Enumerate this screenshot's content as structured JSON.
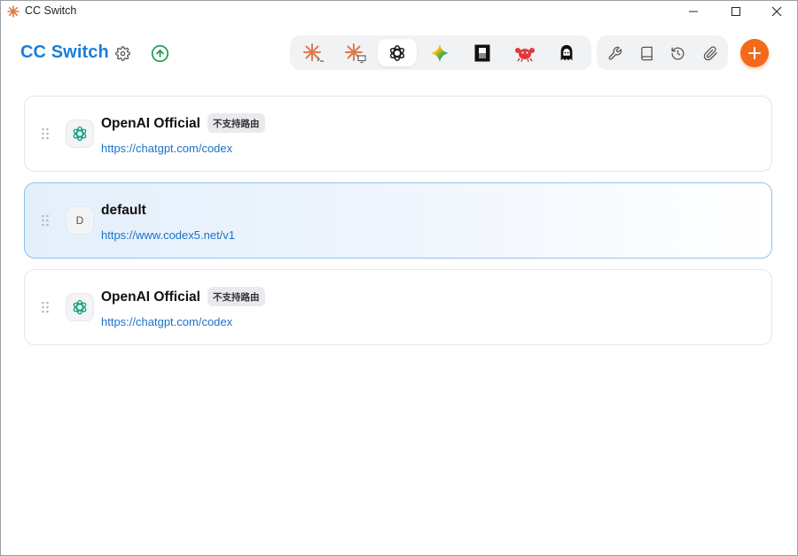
{
  "window": {
    "title": "CC Switch",
    "controls": [
      "minimize",
      "maximize",
      "close"
    ]
  },
  "header": {
    "brand": "CC Switch",
    "brand_color": "#1a7fd4",
    "settings_icon": "gear-icon",
    "update_icon": "arrow-up-circle-icon",
    "app_tabs": [
      {
        "id": "claude-code",
        "icon": "claude-spark-terminal-icon",
        "active": false
      },
      {
        "id": "claude-desktop",
        "icon": "claude-spark-monitor-icon",
        "active": false
      },
      {
        "id": "codex",
        "icon": "openai-logo-icon",
        "active": true
      },
      {
        "id": "gemini",
        "icon": "gemini-star-icon",
        "active": false
      },
      {
        "id": "opencode",
        "icon": "opencode-square-icon",
        "active": false
      },
      {
        "id": "rust-crab",
        "icon": "red-crab-icon",
        "active": false
      },
      {
        "id": "avatar-agent",
        "icon": "ghost-avatar-icon",
        "active": false
      }
    ],
    "tools": [
      {
        "id": "tools",
        "icon": "wrench-icon"
      },
      {
        "id": "docs",
        "icon": "book-icon"
      },
      {
        "id": "history",
        "icon": "history-icon"
      },
      {
        "id": "attachments",
        "icon": "paperclip-icon"
      }
    ],
    "add_icon": "plus-icon",
    "accent": "#f36a1c"
  },
  "providers": [
    {
      "name": "OpenAI Official",
      "tag": "不支持路由",
      "url": "https://chatgpt.com/codex",
      "icon": "openai-logo-icon",
      "active": false
    },
    {
      "name": "default",
      "tag": "",
      "letter": "D",
      "url": "https://www.codex5.net/v1",
      "icon": "letter-avatar",
      "active": true
    },
    {
      "name": "OpenAI Official",
      "tag": "不支持路由",
      "url": "https://chatgpt.com/codex",
      "icon": "openai-logo-icon",
      "active": false
    }
  ]
}
